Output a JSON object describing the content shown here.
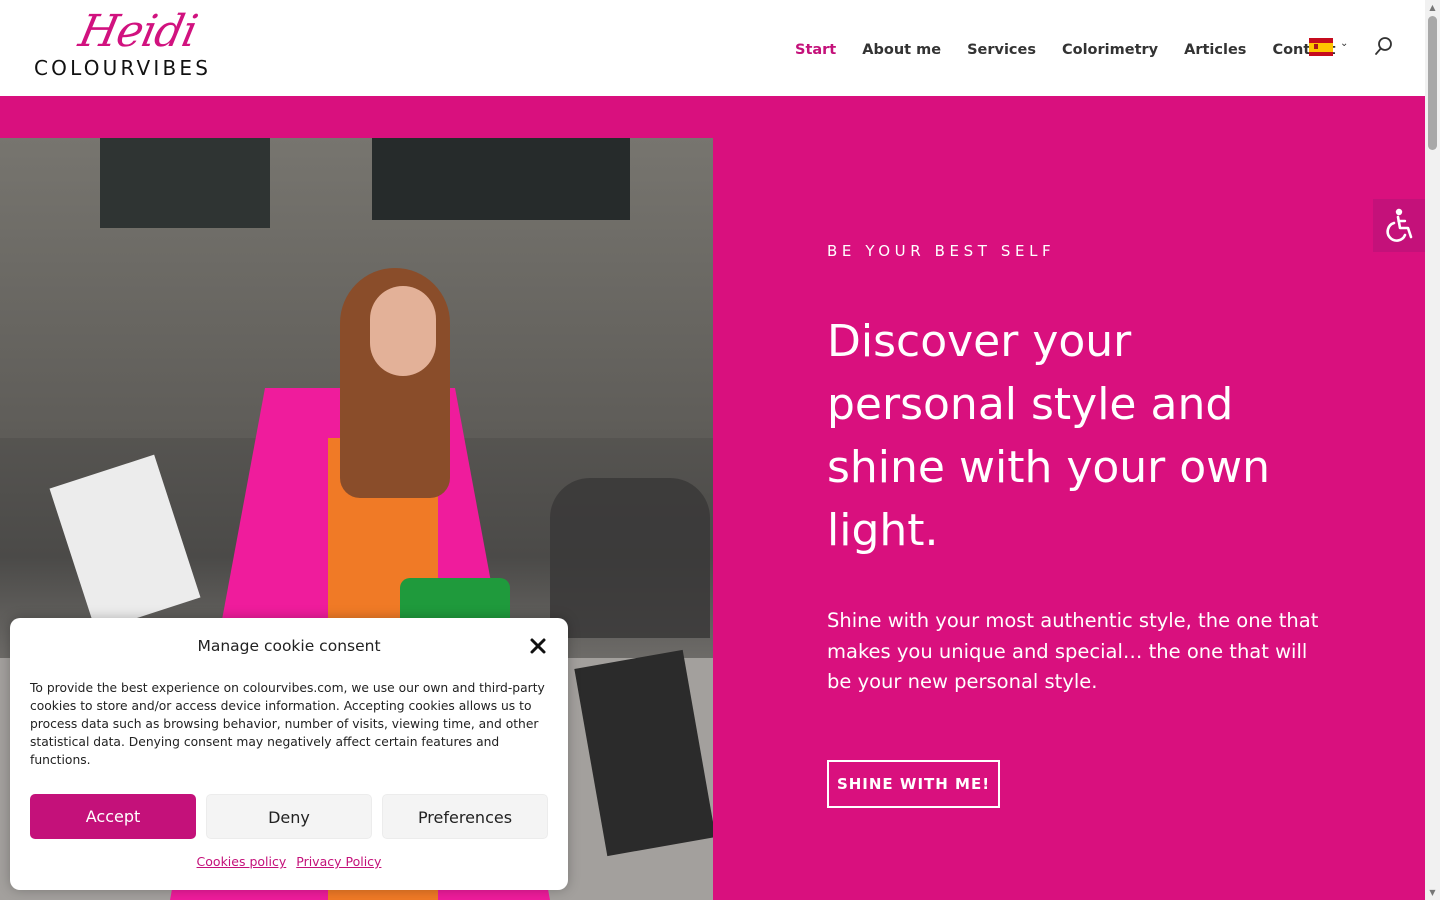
{
  "header": {
    "logo_script": "Heidi",
    "logo_word": "COLOURVIBES",
    "nav": [
      {
        "label": "Start",
        "active": true
      },
      {
        "label": "About me",
        "active": false
      },
      {
        "label": "Services",
        "active": false
      },
      {
        "label": "Colorimetry",
        "active": false
      },
      {
        "label": "Articles",
        "active": false
      },
      {
        "label": "Contact",
        "active": false
      }
    ],
    "language_icon": "spain-flag-icon",
    "search_icon": "search-icon"
  },
  "hero": {
    "eyebrow": "BE YOUR BEST SELF",
    "headline": "Discover your personal style and shine with your own light.",
    "subtext": "Shine with your most authentic style, the one that makes you unique and special… the one that will be your new personal style.",
    "cta": "SHINE WITH ME!"
  },
  "accessibility": {
    "icon": "wheelchair-accessibility-icon"
  },
  "cookie": {
    "title": "Manage cookie consent",
    "body": "To provide the best experience on colourvibes.com, we use our own and third-party cookies to store and/or access device information. Accepting cookies allows us to process data such as browsing behavior, number of visits, viewing time, and other statistical data. Denying consent may negatively affect certain features and functions.",
    "accept": "Accept",
    "deny": "Deny",
    "preferences": "Preferences",
    "link_cookies": "Cookies policy",
    "link_privacy": "Privacy Policy"
  },
  "colors": {
    "brand_magenta": "#d9107e",
    "accent": "#c4117a",
    "text_dark": "#333333"
  }
}
